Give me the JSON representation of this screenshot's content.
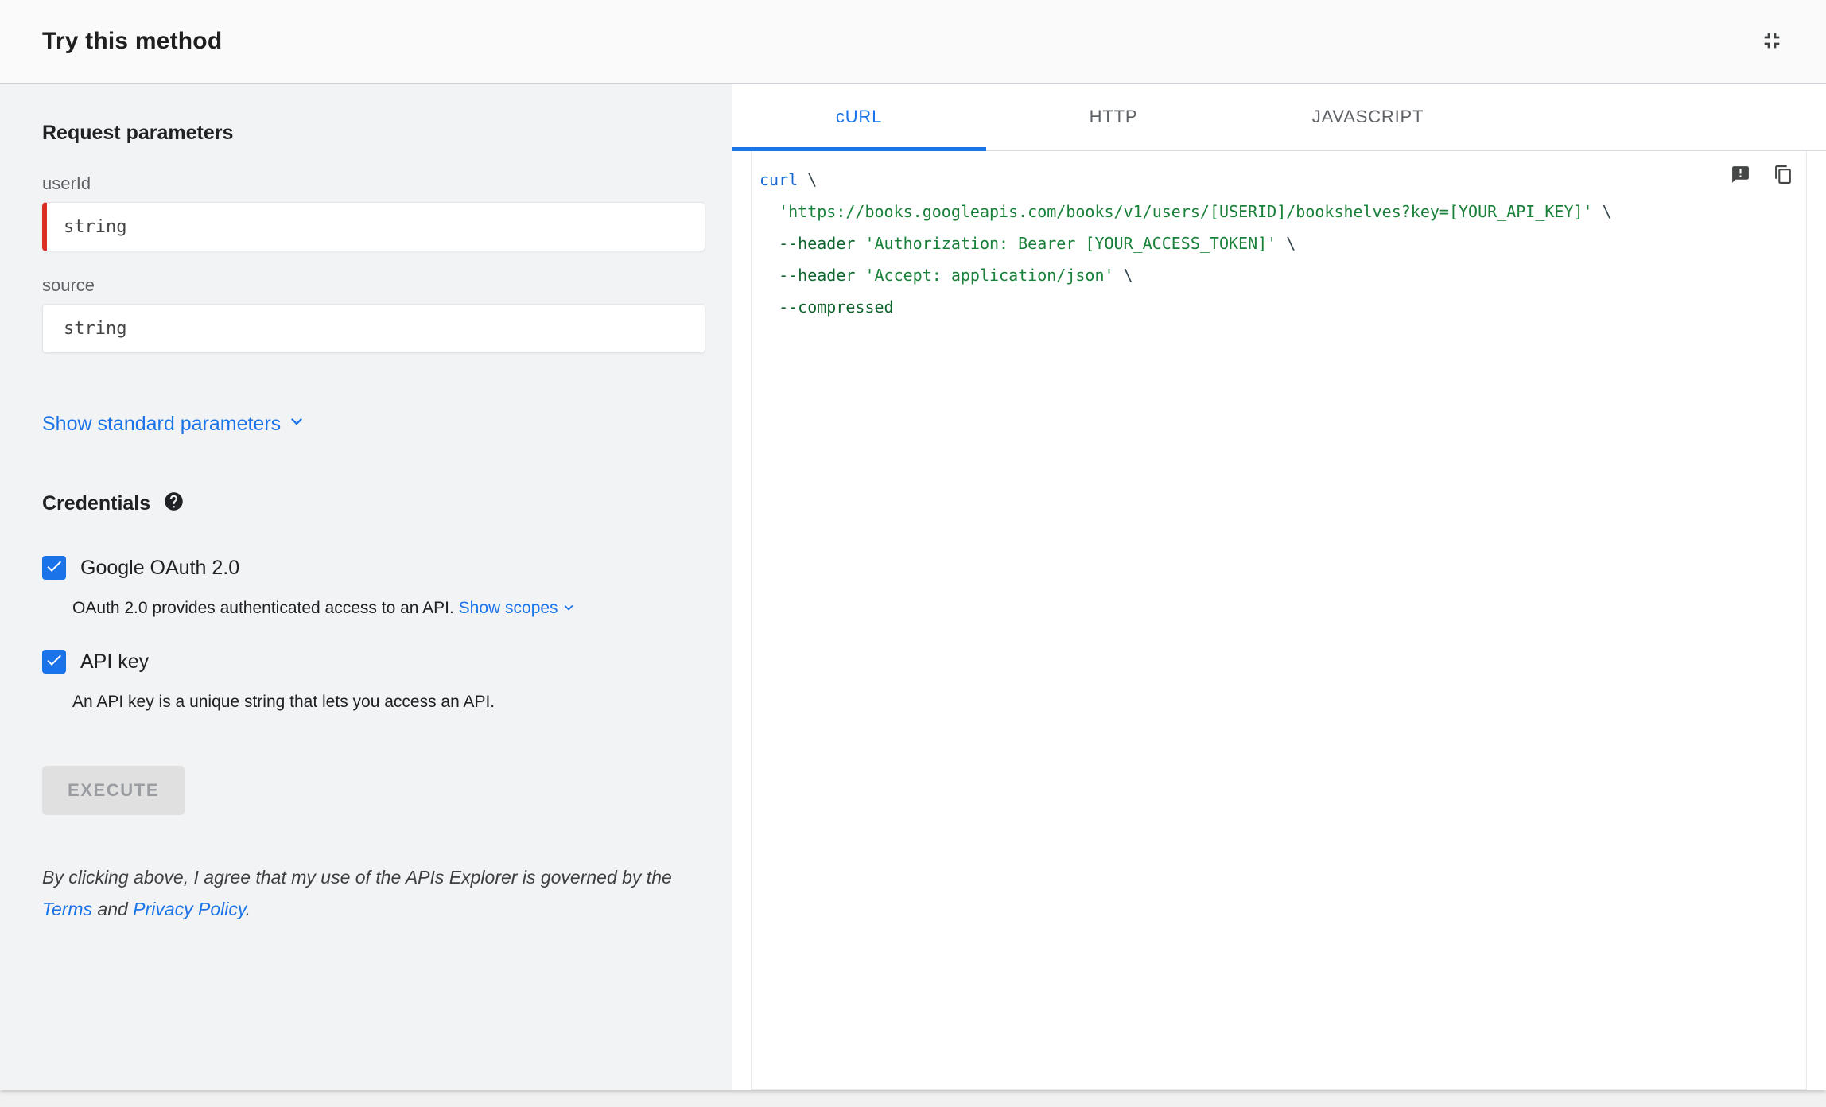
{
  "header": {
    "title": "Try this method"
  },
  "request_params": {
    "heading": "Request parameters",
    "fields": [
      {
        "label": "userId",
        "placeholder": "string",
        "required": true
      },
      {
        "label": "source",
        "placeholder": "string",
        "required": false
      }
    ],
    "show_standard_link": "Show standard parameters"
  },
  "credentials": {
    "heading": "Credentials",
    "options": [
      {
        "label": "Google OAuth 2.0",
        "checked": true,
        "description": "OAuth 2.0 provides authenticated access to an API.",
        "link": "Show scopes"
      },
      {
        "label": "API key",
        "checked": true,
        "description": "An API key is a unique string that lets you access an API."
      }
    ]
  },
  "execute": {
    "label": "EXECUTE",
    "disabled": true
  },
  "disclaimer": {
    "before": "By clicking above, I agree that my use of the APIs Explorer is governed by the ",
    "terms": "Terms",
    "middle": " and ",
    "privacy": "Privacy Policy",
    "after": "."
  },
  "code_panel": {
    "tabs": [
      {
        "label": "cURL",
        "active": true
      },
      {
        "label": "HTTP",
        "active": false
      },
      {
        "label": "JAVASCRIPT",
        "active": false
      }
    ],
    "lines": [
      [
        {
          "t": "curl",
          "c": "kwd"
        },
        {
          "t": " \\",
          "c": "pln"
        }
      ],
      [
        {
          "t": "  ",
          "c": "pln"
        },
        {
          "t": "'https://books.googleapis.com/books/v1/users/[USERID]/bookshelves?key=[YOUR_API_KEY]'",
          "c": "str"
        },
        {
          "t": " \\",
          "c": "pln"
        }
      ],
      [
        {
          "t": "  --header ",
          "c": "flag"
        },
        {
          "t": "'Authorization: Bearer [YOUR_ACCESS_TOKEN]'",
          "c": "str"
        },
        {
          "t": " \\",
          "c": "pln"
        }
      ],
      [
        {
          "t": "  --header ",
          "c": "flag"
        },
        {
          "t": "'Accept: application/json'",
          "c": "str"
        },
        {
          "t": " \\",
          "c": "pln"
        }
      ],
      [
        {
          "t": "  --compressed",
          "c": "flag"
        }
      ]
    ]
  },
  "colors": {
    "accent_blue": "#1a73e8",
    "required_red": "#d93025",
    "left_panel_bg": "#f1f3f4",
    "code_keyword": "#1967d2",
    "code_string": "#188038",
    "code_flag": "#0d652d",
    "disabled_button_bg": "#e0e0e0"
  }
}
